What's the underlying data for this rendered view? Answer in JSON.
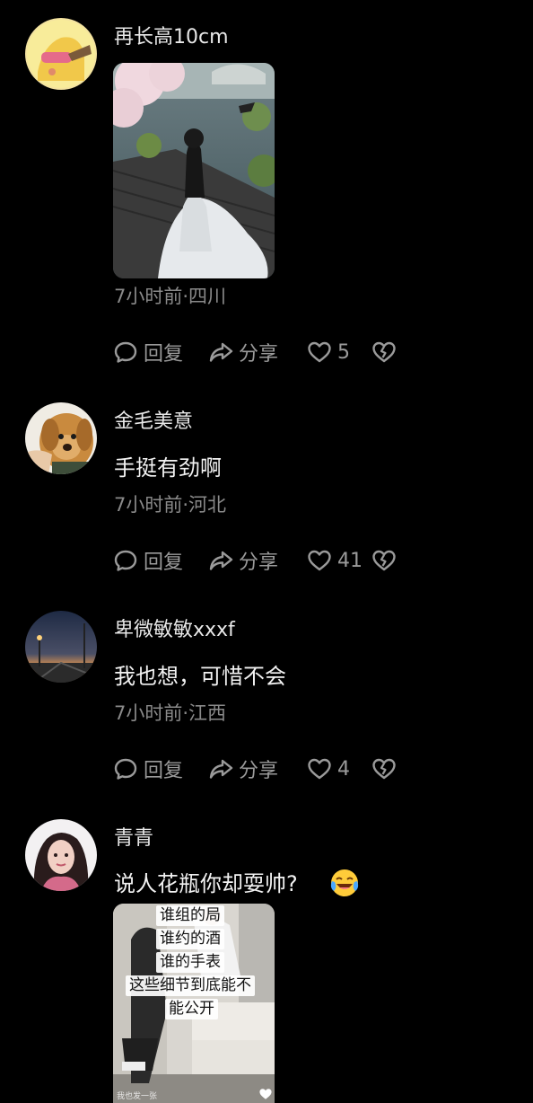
{
  "comments": [
    {
      "username": "再长高10cm",
      "text": "",
      "meta": "7小时前·四川",
      "reply_label": "回复",
      "share_label": "分享",
      "like_count": "5",
      "has_image": true
    },
    {
      "username": "金毛美意",
      "text": "手挺有劲啊",
      "meta": "7小时前·河北",
      "reply_label": "回复",
      "share_label": "分享",
      "like_count": "41"
    },
    {
      "username": "卑微敏敏xxxf",
      "text": "我也想，可惜不会",
      "meta": "7小时前·江西",
      "reply_label": "回复",
      "share_label": "分享",
      "like_count": "4"
    },
    {
      "username": "青青",
      "text": "说人花瓶你却耍帅?",
      "emoji": "laughing-crying-emoji",
      "image_overlay": [
        "谁组的局",
        "谁约的酒",
        "谁的手表",
        "这些细节到底能不",
        "能公开"
      ],
      "image_caption": "我也发一张"
    }
  ],
  "icons": {
    "reply": "comment-bubble-icon",
    "share": "share-arrow-icon",
    "like": "heart-icon",
    "dislike": "broken-heart-icon"
  },
  "colors": {
    "background": "#000000",
    "text": "#f2f2f2",
    "meta": "#8a8a8a",
    "action": "#9a9a9a"
  }
}
